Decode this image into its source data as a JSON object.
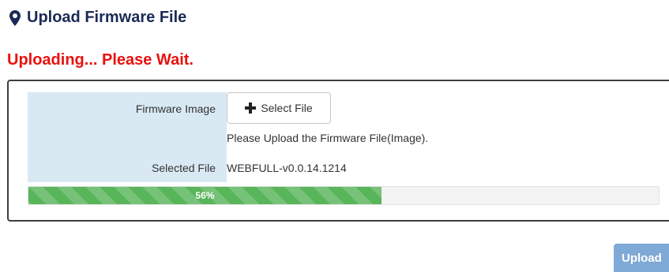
{
  "header": {
    "title": "Upload Firmware File",
    "icon": "map-marker-icon",
    "title_color": "#1b2a55"
  },
  "status": {
    "text": "Uploading... Please Wait.",
    "color": "#e8110e"
  },
  "form": {
    "firmware_image_label": "Firmware Image",
    "select_file_button": "Select File",
    "select_file_icon": "plus-icon",
    "hint": "Please Upload the Firmware File(Image).",
    "selected_file_label": "Selected File",
    "selected_file_value": "WEBFULL-v0.0.14.1214"
  },
  "progress": {
    "percent": 56,
    "label": "56%",
    "color": "#58b55a"
  },
  "actions": {
    "upload_button": "Upload",
    "upload_color": "#7fa9d6"
  }
}
